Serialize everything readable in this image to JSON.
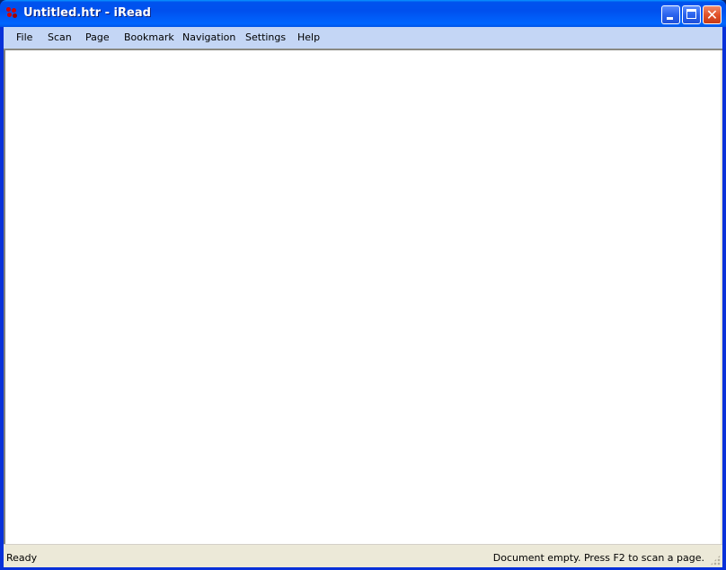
{
  "window": {
    "title": "Untitled.htr - iRead",
    "app_icon": "iread-app-icon",
    "controls": {
      "minimize": "minimize-icon",
      "maximize": "maximize-icon",
      "close": "close-icon",
      "close_glyph": "✕"
    }
  },
  "menubar": {
    "items": [
      {
        "label": "File"
      },
      {
        "label": "Scan"
      },
      {
        "label": "Page"
      },
      {
        "label": "Bookmark"
      },
      {
        "label": "Navigation"
      },
      {
        "label": "Settings"
      },
      {
        "label": "Help"
      }
    ]
  },
  "document": {
    "content": ""
  },
  "statusbar": {
    "left": "Ready",
    "right": "Document empty. Press F2 to scan a page."
  },
  "colors": {
    "titlebar": "#0053ee",
    "menubar": "#c4d6f5",
    "statusbar": "#ece9d8",
    "close_button": "#e2532a"
  }
}
